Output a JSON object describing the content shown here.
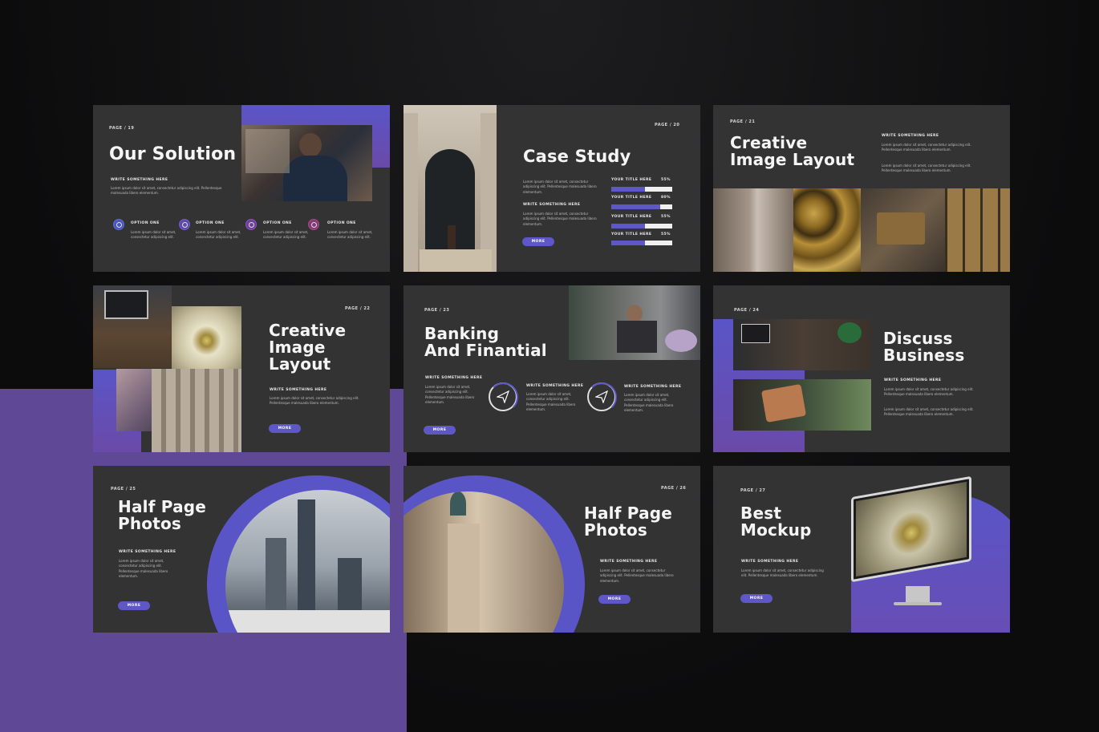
{
  "slides": {
    "our_solution": {
      "page": "PAGE / 19",
      "title": "Our Solution",
      "subtitle": "WRITE SOMETHING HERE",
      "body": "Lorem ipsum dolor sit amet, consectetur adipiscing elit. Pellentesque malesuada libero elementum.",
      "options": [
        {
          "label": "OPTION ONE",
          "text": "Lorem ipsum dolor sit amet, consectetur adipiscing elit.",
          "color": "#5b6bd6"
        },
        {
          "label": "OPTION ONE",
          "text": "Lorem ipsum dolor sit amet, consectetur adipiscing elit.",
          "color": "#7a5bc9"
        },
        {
          "label": "OPTION ONE",
          "text": "Lorem ipsum dolor sit amet, consectetur adipiscing elit.",
          "color": "#8c4fb8"
        },
        {
          "label": "OPTION ONE",
          "text": "Lorem ipsum dolor sit amet, consectetur adipiscing elit.",
          "color": "#a8488f"
        }
      ]
    },
    "case_study": {
      "page": "PAGE / 20",
      "title": "Case Study",
      "body1": "Lorem ipsum dolor sit amet, consectetur adipiscing elit. Pellentesque malesuada libero elementum.",
      "subtitle": "WRITE SOMETHING HERE",
      "body2": "Lorem ipsum dolor sit amet, consectetur adipiscing elit. Pellentesque malesuada libero elementum.",
      "more": "MORE",
      "bars": [
        {
          "label": "YOUR TITLE HERE",
          "value": "55%",
          "fill": 0.55
        },
        {
          "label": "YOUR TITLE HERE",
          "value": "80%",
          "fill": 0.8
        },
        {
          "label": "YOUR TITLE HERE",
          "value": "55%",
          "fill": 0.55
        },
        {
          "label": "YOUR TITLE HERE",
          "value": "55%",
          "fill": 0.55
        }
      ]
    },
    "creative_1": {
      "page": "PAGE / 21",
      "title_l1": "Creative",
      "title_l2": "Image Layout",
      "subtitle": "WRITE SOMETHING HERE",
      "body1": "Lorem ipsum dolor sit amet, consectetur adipiscing elit. Pellentesque malesuada libero elementum.",
      "body2": "Lorem ipsum dolor sit amet, consectetur adipiscing elit. Pellentesque malesuada libero elementum."
    },
    "creative_2": {
      "page": "PAGE / 22",
      "title_l1": "Creative",
      "title_l2": "Image",
      "title_l3": "Layout",
      "subtitle": "WRITE SOMETHING HERE",
      "body": "Lorem ipsum dolor sit amet, consectetur adipiscing elit. Pellentesque malesuada libero elementum.",
      "more": "MORE"
    },
    "banking": {
      "page": "PAGE / 23",
      "title_l1": "Banking",
      "title_l2": "And Finantial",
      "subtitle": "WRITE SOMETHING HERE",
      "body": "Lorem ipsum dolor sit amet, consectetur adipiscing elit. Pellentesque malesuada libero elementum.",
      "col1_title": "WRITE SOMETHING HERE",
      "col1_body": "Lorem ipsum dolor sit amet, consectetur adipiscing elit. Pellentesque malesuada libero elementum.",
      "col2_title": "WRITE SOMETHING HERE",
      "col2_body": "Lorem ipsum dolor sit amet, consectetur adipiscing elit. Pellentesque malesuada libero elementum.",
      "more": "MORE"
    },
    "discuss": {
      "page": "PAGE / 24",
      "title_l1": "Discuss",
      "title_l2": "Business",
      "subtitle": "WRITE SOMETHING HERE",
      "body1": "Lorem ipsum dolor sit amet, consectetur adipiscing elit. Pellentesque malesuada libero elementum.",
      "body2": "Lorem ipsum dolor sit amet, consectetur adipiscing elit. Pellentesque malesuada libero elementum."
    },
    "half_1": {
      "page": "PAGE / 25",
      "title_l1": "Half Page",
      "title_l2": "Photos",
      "subtitle": "WRITE SOMETHING HERE",
      "body": "Lorem ipsum dolor sit amet, consectetur adipiscing elit. Pellentesque malesuada libero elementum.",
      "more": "MORE"
    },
    "half_2": {
      "page": "PAGE / 26",
      "title_l1": "Half Page",
      "title_l2": "Photos",
      "subtitle": "WRITE SOMETHING HERE",
      "body": "Lorem ipsum dolor sit amet, consectetur adipiscing elit. Pellentesque malesuada libero elementum.",
      "more": "MORE"
    },
    "mockup": {
      "page": "PAGE / 27",
      "title_l1": "Best",
      "title_l2": "Mockup",
      "subtitle": "WRITE SOMETHING HERE",
      "body": "Lorem ipsum dolor sit amet, consectetur adipiscing elit. Pellentesque malesuada libero elementum.",
      "more": "MORE"
    }
  },
  "colors": {
    "accent": "#5d57c8",
    "purple_bg": "#5f4996",
    "slide_bg": "#333334",
    "page_bg": "#0c0c0d"
  }
}
